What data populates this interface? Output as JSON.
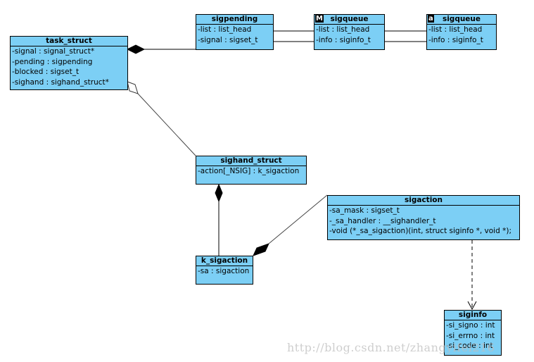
{
  "classes": {
    "task_struct": {
      "name": "task_struct",
      "attrs": [
        "-signal : signal_struct*",
        "-pending : sigpending",
        "-blocked : sigset_t",
        "-sighand : sighand_struct*"
      ]
    },
    "sigpending": {
      "name": "sigpending",
      "attrs": [
        "-list : list_head",
        "-signal : sigset_t"
      ]
    },
    "sigqueue_m": {
      "name": "sigqueue",
      "badge": "M",
      "attrs": [
        "-list : list_head",
        "-info : siginfo_t"
      ]
    },
    "sigqueue_a": {
      "name": "sigqueue",
      "badge": "a",
      "attrs": [
        "-list : list_head",
        "-info : siginfo_t"
      ]
    },
    "sighand_struct": {
      "name": "sighand_struct",
      "attrs": [
        "-action[_NSIG] : k_sigaction"
      ]
    },
    "sigaction": {
      "name": "sigaction",
      "attrs": [
        "-sa_mask : sigset_t",
        "-_sa_handler : __sighandler_t",
        "-void (*_sa_sigaction)(int, struct siginfo *, void *);"
      ]
    },
    "k_sigaction": {
      "name": "k_sigaction",
      "attrs": [
        "-sa : sigaction"
      ]
    },
    "siginfo": {
      "name": "siginfo",
      "attrs": [
        "-si_signo : int",
        "-si_errno : int",
        "-si_code : int"
      ]
    }
  },
  "relations": [
    {
      "from": "task_struct",
      "to": "sigpending",
      "type": "composition"
    },
    {
      "from": "task_struct",
      "to": "sighand_struct",
      "type": "aggregation"
    },
    {
      "from": "sigpending",
      "to": "sigqueue",
      "type": "association"
    },
    {
      "from": "sigqueue",
      "to": "sigqueue",
      "type": "association"
    },
    {
      "from": "sighand_struct",
      "to": "k_sigaction",
      "type": "composition"
    },
    {
      "from": "k_sigaction",
      "to": "sigaction",
      "type": "composition"
    },
    {
      "from": "sigaction",
      "to": "siginfo",
      "type": "dependency"
    }
  ],
  "colors": {
    "class_fill": "#7ccff5",
    "line": "#000000"
  },
  "watermark": "http://blog.csdn.net/zhangyifei216"
}
